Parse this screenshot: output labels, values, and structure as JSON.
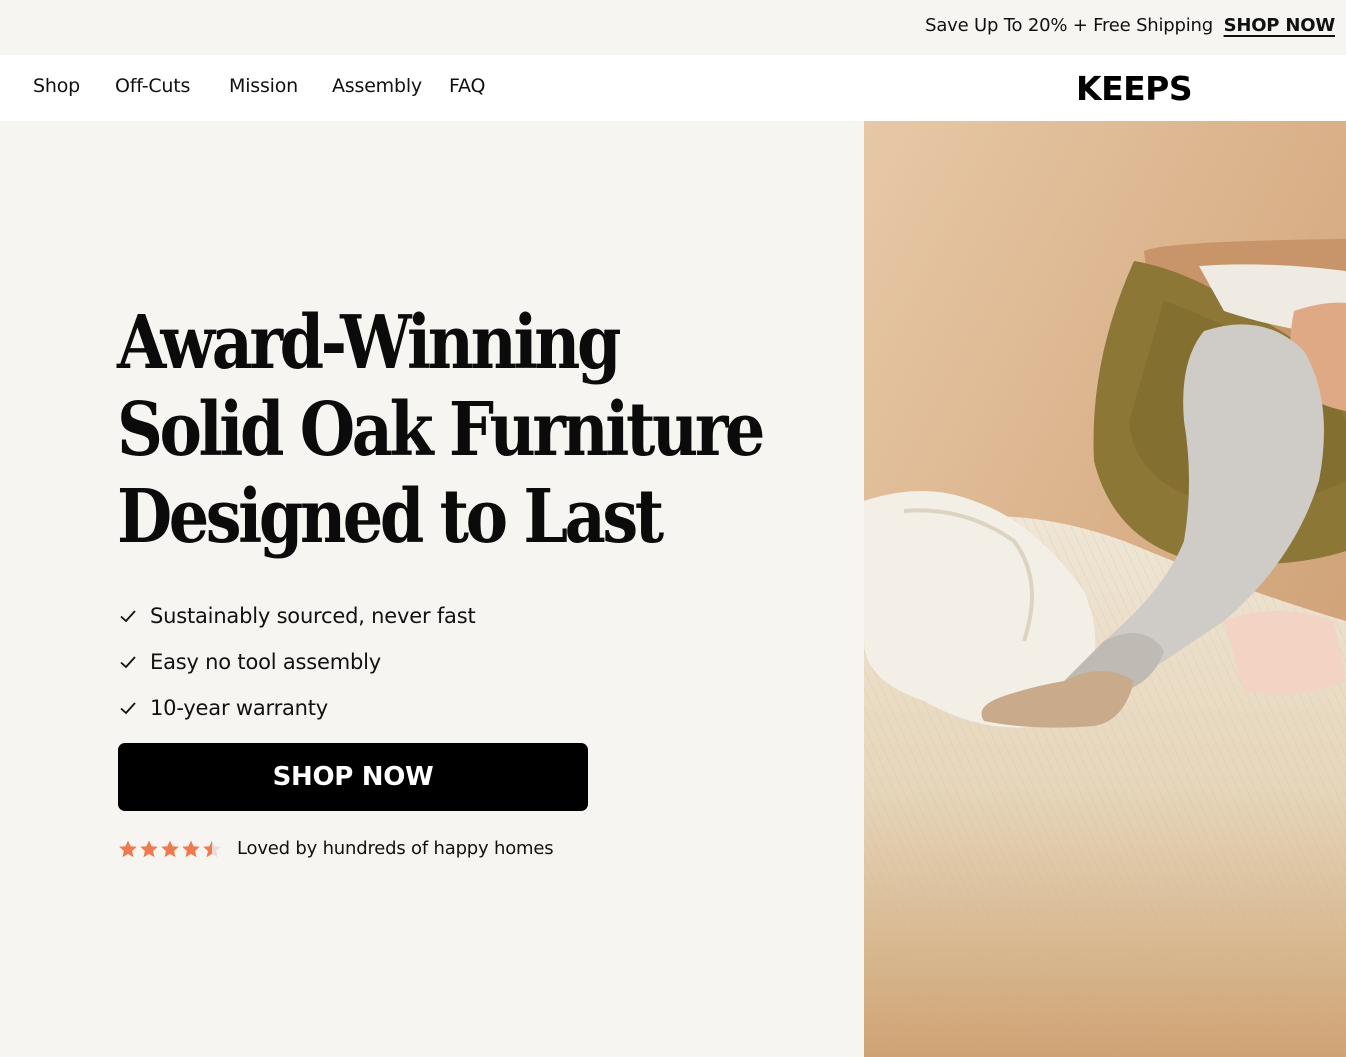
{
  "announcement": {
    "text": "Save Up To 20% + Free Shipping",
    "link_label": "SHOP NOW"
  },
  "nav": {
    "items": [
      {
        "label": "Shop"
      },
      {
        "label": "Off-Cuts"
      },
      {
        "label": "Mission"
      },
      {
        "label": "Assembly"
      },
      {
        "label": "FAQ"
      }
    ],
    "logo": "KEEPS"
  },
  "hero": {
    "headline_lines": [
      "Award-Winning",
      "Solid Oak Furniture",
      "Designed to Last"
    ],
    "features": [
      {
        "text": "Sustainably sourced, never fast",
        "icon": "check-icon"
      },
      {
        "text": "Easy no tool assembly",
        "icon": "check-icon"
      },
      {
        "text": "10-year warranty",
        "icon": "check-icon"
      }
    ],
    "cta_label": "SHOP NOW",
    "rating": {
      "stars": 4.5,
      "max_stars": 5,
      "text": "Loved by hundreds of happy homes",
      "star_color": "#f07a4f"
    },
    "image_icon": "bed-photo"
  },
  "colors": {
    "background": "#f6f5f1",
    "nav_background": "#ffffff",
    "button": "#000000",
    "star": "#f07a4f"
  }
}
